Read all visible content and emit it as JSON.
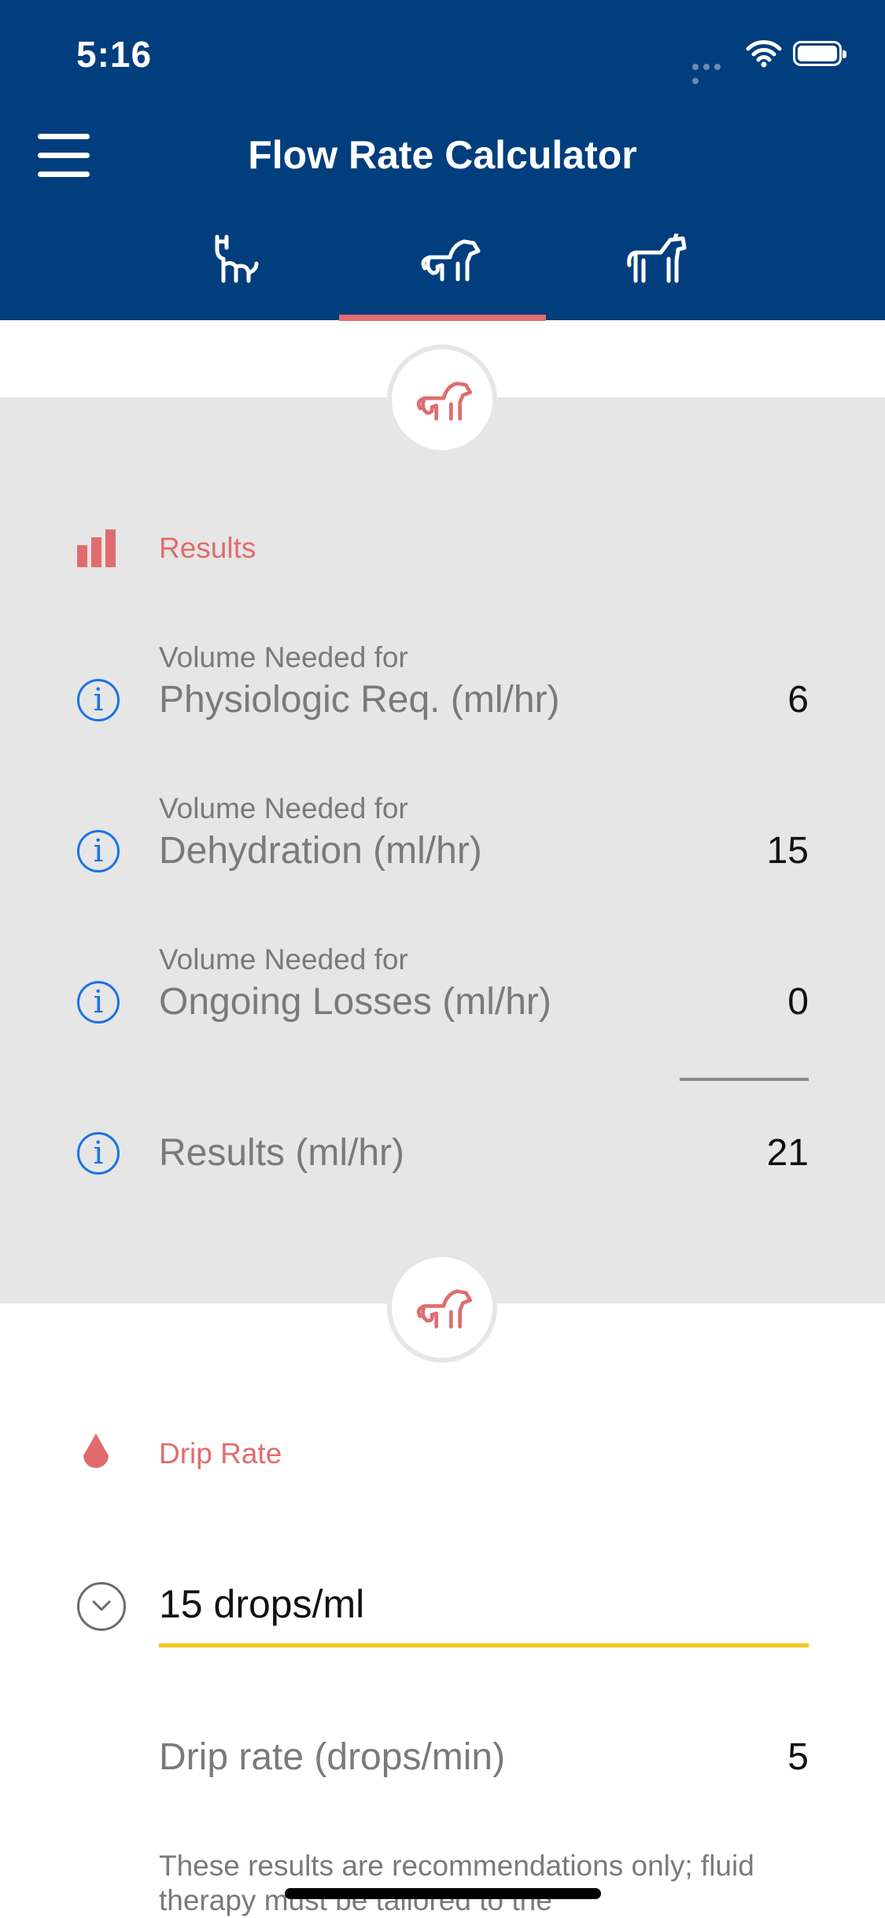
{
  "status_bar": {
    "time": "5:16"
  },
  "header": {
    "title": "Flow Rate Calculator",
    "tabs": [
      {
        "name": "cat",
        "icon": "cat-icon",
        "selected": false
      },
      {
        "name": "dog",
        "icon": "dog-icon",
        "selected": true
      },
      {
        "name": "horse",
        "icon": "horse-icon",
        "selected": false
      }
    ]
  },
  "results": {
    "label": "Results",
    "rows": [
      {
        "sub": "Volume Needed for",
        "main": "Physiologic Req. (ml/hr)",
        "value": "6"
      },
      {
        "sub": "Volume Needed for",
        "main": "Dehydration (ml/hr)",
        "value": "15"
      },
      {
        "sub": "Volume Needed for",
        "main": "Ongoing Losses (ml/hr)",
        "value": "0"
      }
    ],
    "total": {
      "main": "Results (ml/hr)",
      "value": "21"
    }
  },
  "drip": {
    "label": "Drip Rate",
    "selected": "15 drops/ml",
    "rate_label": "Drip rate (drops/min)",
    "rate_value": "5"
  },
  "disclaimer": "These results are recommendations only; fluid therapy must be tailored to the",
  "colors": {
    "header_bg": "#003e7e",
    "accent": "#e06c6e",
    "info": "#1a73e8",
    "panel_bg": "#e6e6e6",
    "underline": "#f5c518"
  }
}
